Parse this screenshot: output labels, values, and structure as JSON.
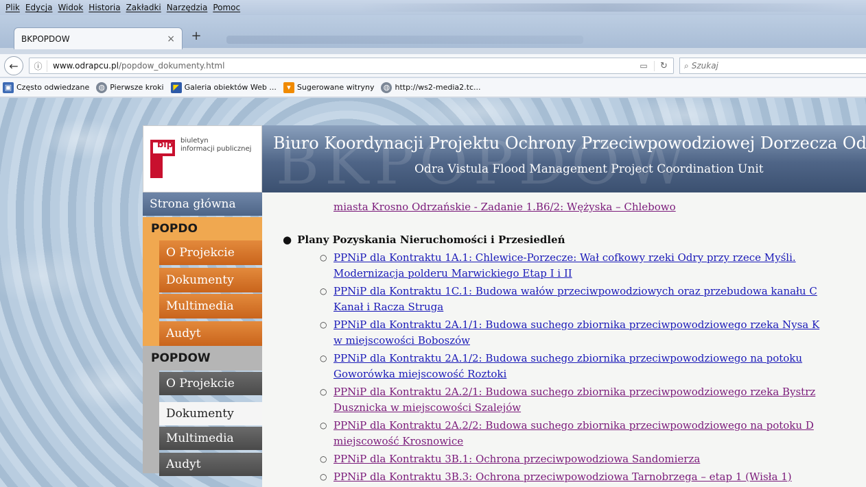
{
  "browser": {
    "menu": [
      "Plik",
      "Edycja",
      "Widok",
      "Historia",
      "Zakładki",
      "Narzędzia",
      "Pomoc"
    ],
    "tab_title": "BKPOPDOW",
    "tab_close": "×",
    "new_tab": "+",
    "url_domain": "www.odrapcu.pl",
    "url_path": "/popdow_dokumenty.html",
    "search_placeholder": "Szukaj",
    "bookmarks": [
      {
        "label": "Często odwiedzane",
        "icon": "often-visited-icon"
      },
      {
        "label": "Pierwsze kroki",
        "icon": "globe-icon"
      },
      {
        "label": "Galeria obiektów Web ...",
        "icon": "web-gallery-icon"
      },
      {
        "label": "Sugerowane witryny",
        "icon": "suggested-sites-icon"
      },
      {
        "label": "http://ws2-media2.tc...",
        "icon": "globe-icon"
      }
    ]
  },
  "site": {
    "bip_text": "biuletyn\ninformacji publicznej",
    "bip_word": "bip",
    "banner_bg": "BKPOPDOW",
    "title": "Biuro Koordynacji Projektu Ochrony Przeciwpowodziowej Dorzecza Odry",
    "subtitle": "Odra Vistula Flood Management Project Coordination Unit"
  },
  "nav": {
    "home": "Strona główna",
    "popdo": {
      "label": "POPDO",
      "items": [
        "O Projekcie",
        "Dokumenty",
        "Multimedia",
        "Audyt"
      ]
    },
    "popdow": {
      "label": "POPDOW",
      "items": [
        "O Projekcie",
        "Dokumenty",
        "Multimedia",
        "Audyt"
      ]
    },
    "active": "Dokumenty"
  },
  "content": {
    "top_link": "miasta Krosno Odrzańskie - Zadanie 1.B6/2: Wężyska – Chlebowo",
    "section_heading": "Plany Pozyskania Nieruchomości i Przesiedleń",
    "documents": [
      {
        "lines": [
          "PPNiP dla Kontraktu 1A.1: Chlewice-Porzecze: Wał cofkowy rzeki Odry przy rzece Myśli.",
          "Modernizacja polderu Marwickiego Etap I i II"
        ],
        "visited": false
      },
      {
        "lines": [
          "PPNiP dla Kontraktu 1C.1: Budowa wałów przeciwpowodziowych oraz przebudowa kanału C",
          "Kanał i Racza Struga"
        ],
        "visited": false
      },
      {
        "lines": [
          "PPNiP dla Kontraktu 2A.1/1: Budowa suchego zbiornika przeciwpowodziowego rzeka Nysa K",
          "w miejscowości Boboszów"
        ],
        "visited": false
      },
      {
        "lines": [
          "PPNiP dla Kontraktu 2A.1/2: Budowa suchego zbiornika przeciwpowodziowego na potoku",
          "Goworówka miejscowość Roztoki"
        ],
        "visited": false
      },
      {
        "lines": [
          "PPNiP dla Kontraktu 2A.2/1: Budowa suchego zbiornika przeciwpowodziowego rzeka Bystrz",
          "Dusznicka w miejscowości Szalejów"
        ],
        "visited": true
      },
      {
        "lines": [
          "PPNiP dla Kontraktu 2A.2/2: Budowa suchego zbiornika przeciwpowodziowego na potoku D",
          "miejscowość Krosnowice"
        ],
        "visited": true
      },
      {
        "lines": [
          "PPNiP dla Kontraktu 3B.1: Ochrona przeciwpowodziowa Sandomierza"
        ],
        "visited": true
      },
      {
        "lines": [
          "PPNiP dla Kontraktu 3B.3: Ochrona przeciwpowodziowa Tarnobrzega – etap 1 (Wisła 1)"
        ],
        "visited": true
      }
    ]
  },
  "colors": {
    "popdo_orange": "#f0a850",
    "popdo_item": "#d9782e",
    "popdow_grey": "#b5b5b5",
    "popdow_item": "#5a5a5a",
    "link": "#1a1ab8",
    "visited_link": "#7a1a7a"
  }
}
